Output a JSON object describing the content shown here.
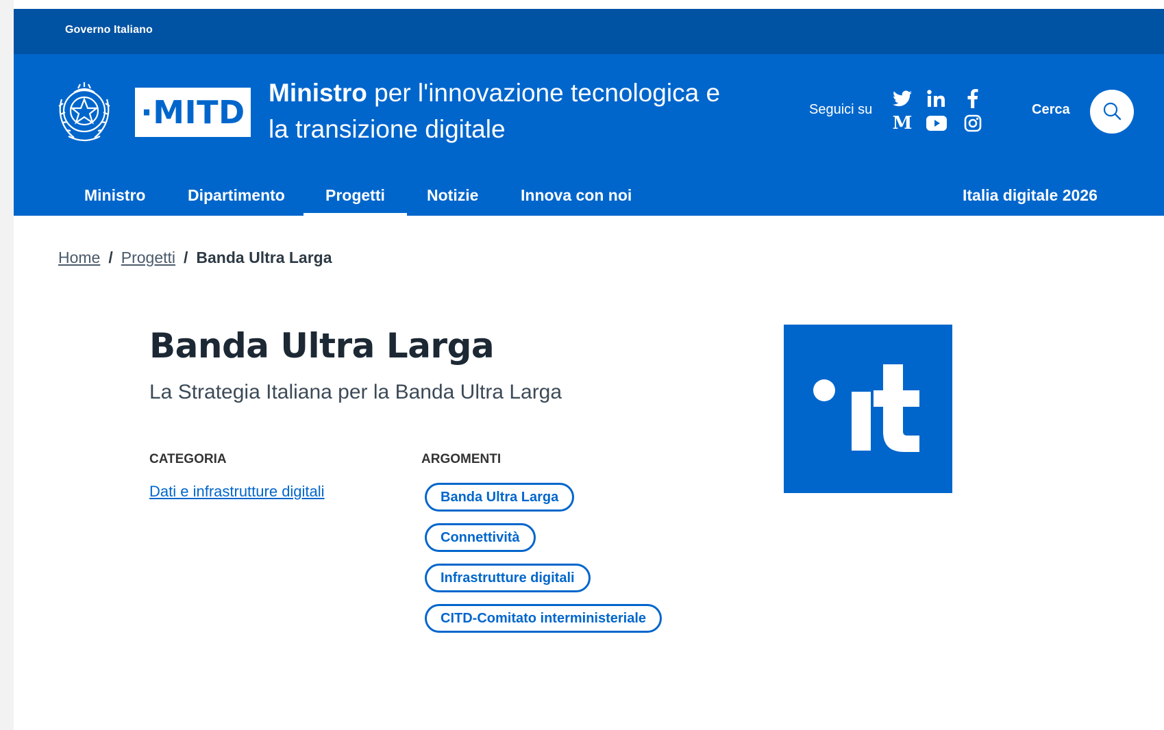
{
  "topbar": {
    "gov_label": "Governo Italiano"
  },
  "header": {
    "logo_text": "·MITD",
    "title_strong": "Ministro",
    "title_rest": " per l'innovazione tecnologica e la transizione digitale",
    "follow_label": "Seguici su",
    "social_icons": [
      "twitter-icon",
      "linkedin-icon",
      "facebook-icon",
      "medium-icon",
      "youtube-icon",
      "instagram-icon"
    ],
    "search_label": "Cerca"
  },
  "nav": {
    "items": [
      "Ministro",
      "Dipartimento",
      "Progetti",
      "Notizie",
      "Innova con noi"
    ],
    "active": "Progetti",
    "right_item": "Italia digitale 2026"
  },
  "breadcrumb": {
    "home": "Home",
    "section": "Progetti",
    "separator": "/",
    "current": "Banda Ultra Larga"
  },
  "content": {
    "title": "Banda Ultra Larga",
    "subtitle": "La Strategia Italiana per la Banda Ultra Larga",
    "category_label": "CATEGORIA",
    "category_link": "Dati e infrastrutture digitali",
    "arguments_label": "ARGOMENTI",
    "chips": [
      "Banda Ultra Larga",
      "Connettività",
      "Infrastrutture digitali",
      "CITD-Comitato interministeriale"
    ]
  },
  "colors": {
    "primary": "#0066cc",
    "topbar": "#0052a3"
  }
}
